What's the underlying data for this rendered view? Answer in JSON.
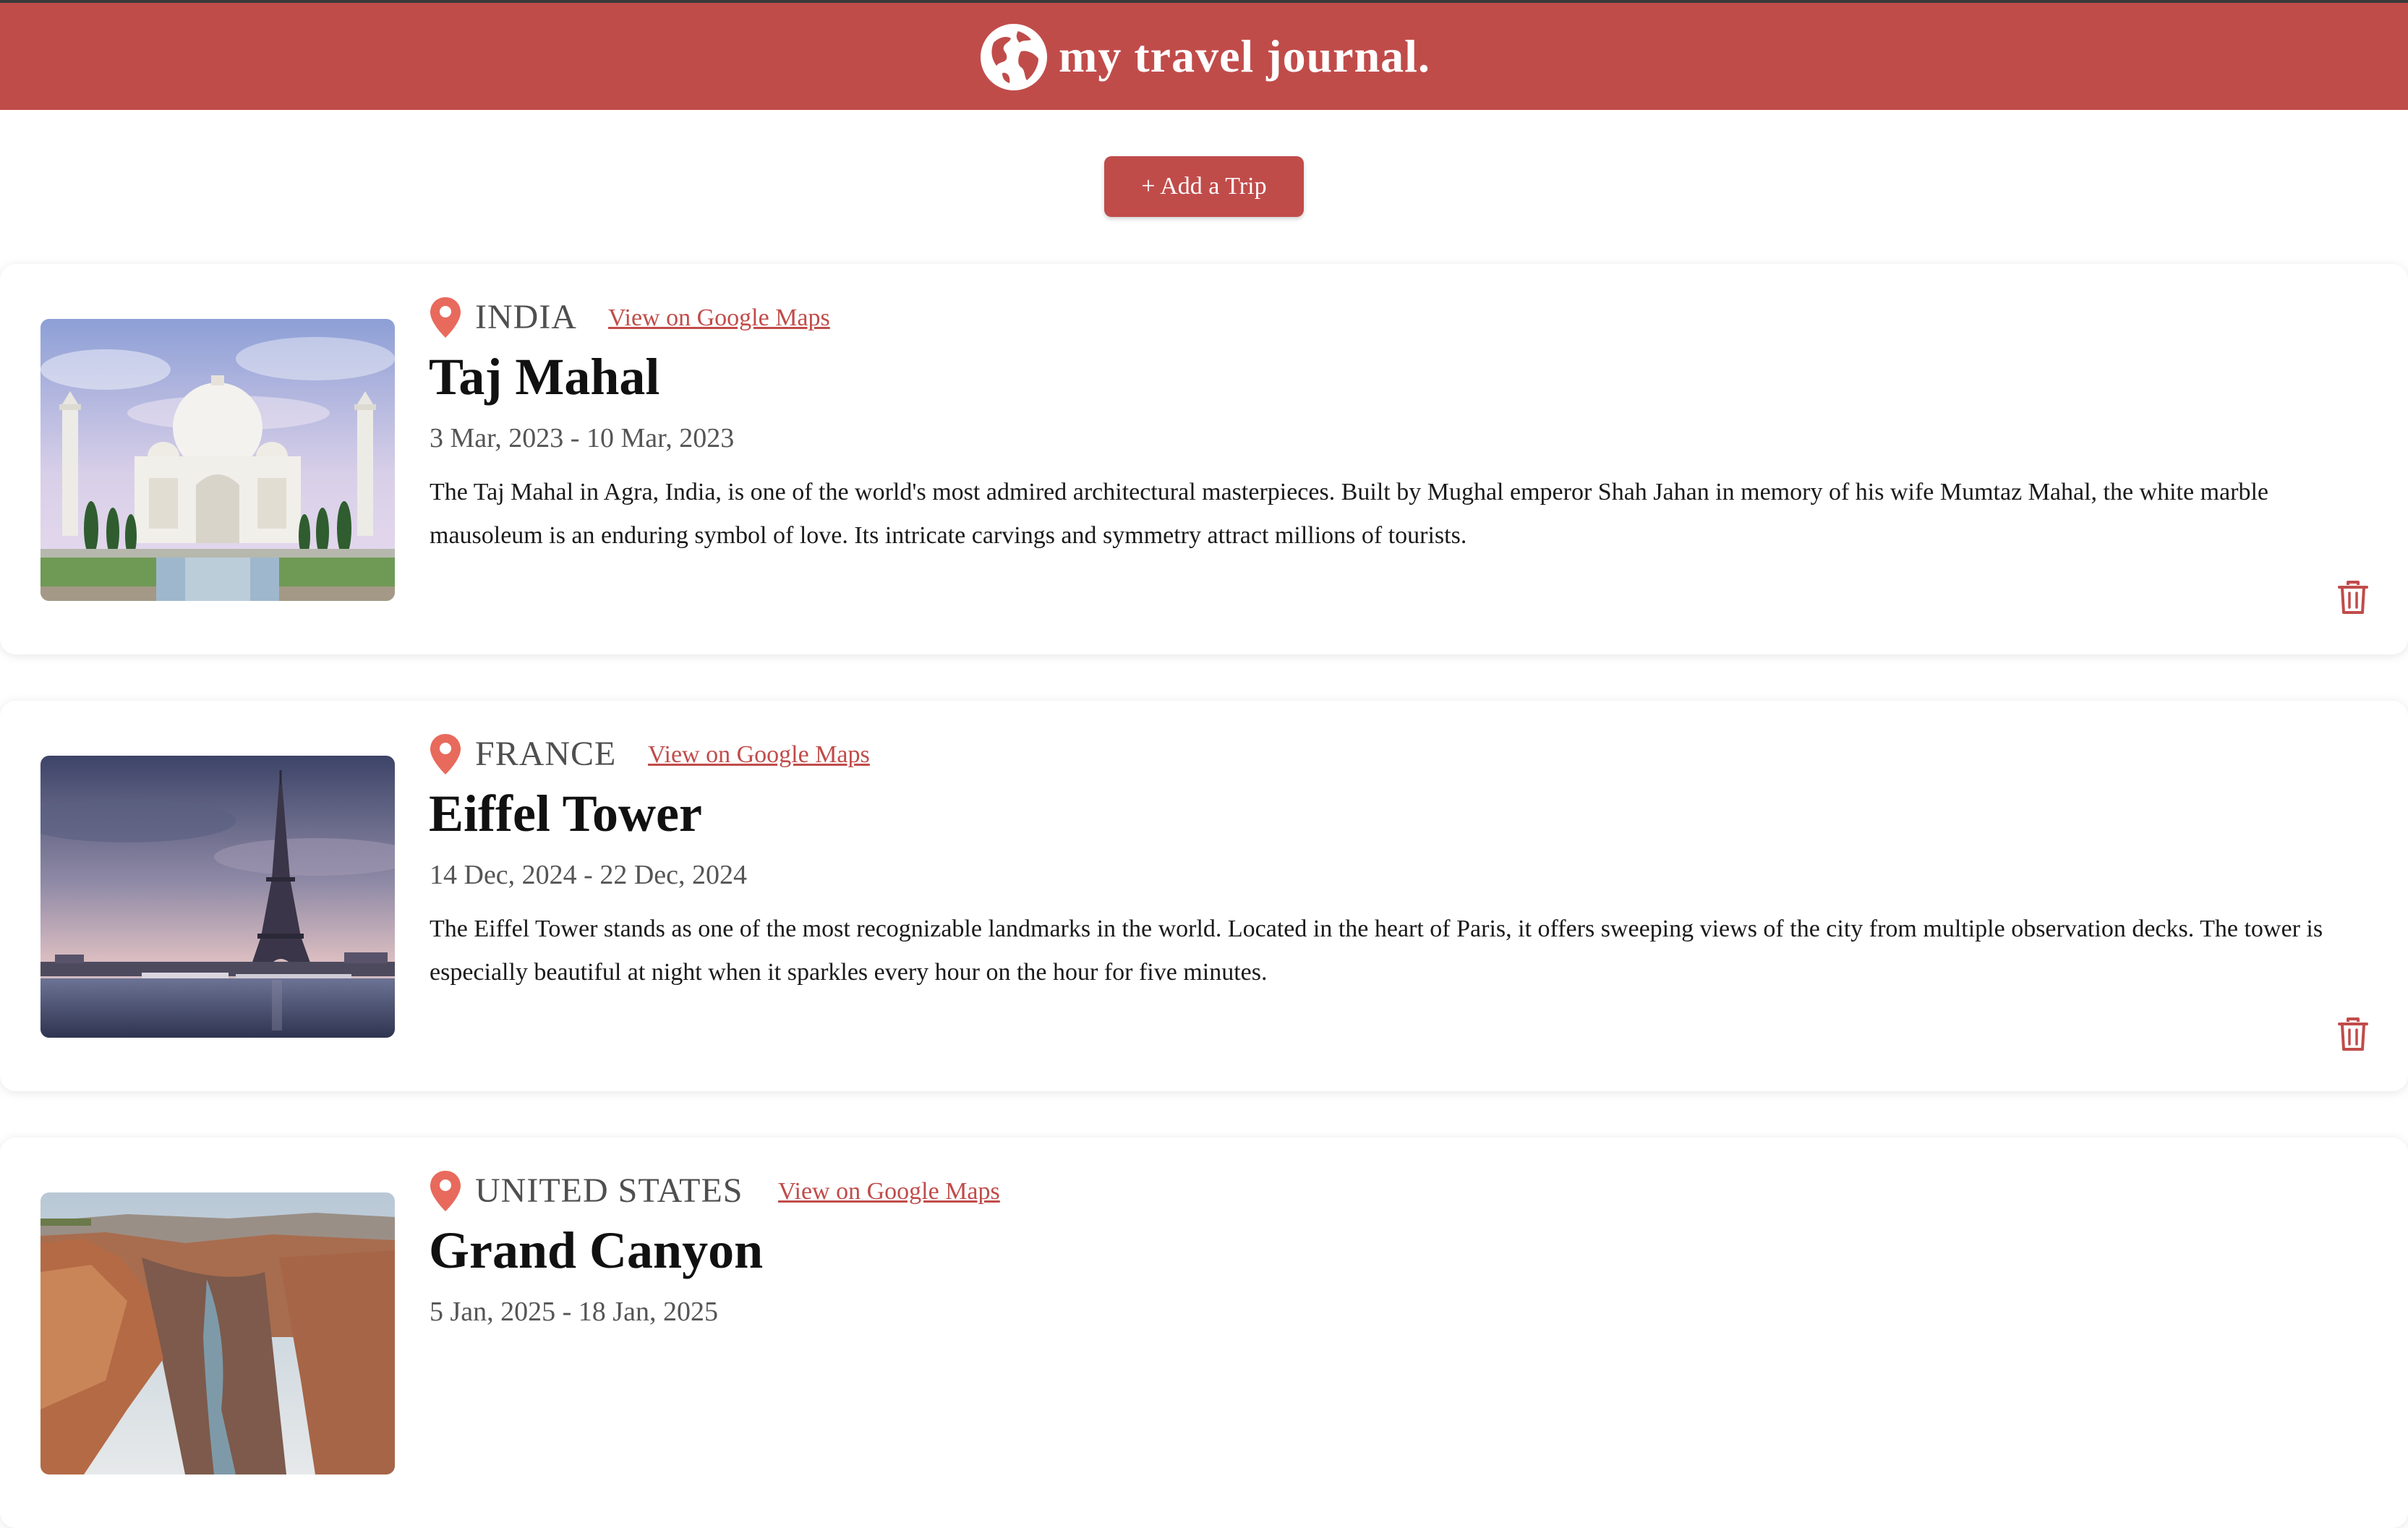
{
  "header": {
    "brand": "my travel journal.",
    "logo_icon": "globe-icon",
    "background": "#c04c4a"
  },
  "toolbar": {
    "add_trip_label": "+ Add a Trip"
  },
  "colors": {
    "accent": "#c04c4a",
    "pin": "#e86a5c"
  },
  "trips": [
    {
      "country": "INDIA",
      "maps_label": "View on Google Maps",
      "title": "Taj Mahal",
      "dates": "3 Mar, 2023 - 10 Mar, 2023",
      "description": "The Taj Mahal in Agra, India, is one of the world's most admired architectural masterpieces. Built by Mughal emperor Shah Jahan in memory of his wife Mumtaz Mahal, the white marble mausoleum is an enduring symbol of love. Its intricate carvings and symmetry attract millions of tourists.",
      "image": "taj-mahal-photo"
    },
    {
      "country": "FRANCE",
      "maps_label": "View on Google Maps",
      "title": "Eiffel Tower",
      "dates": "14 Dec, 2024 - 22 Dec, 2024",
      "description": "The Eiffel Tower stands as one of the most recognizable landmarks in the world. Located in the heart of Paris, it offers sweeping views of the city from multiple observation decks. The tower is especially beautiful at night when it sparkles every hour on the hour for five minutes.",
      "image": "eiffel-tower-photo"
    },
    {
      "country": "UNITED STATES",
      "maps_label": "View on Google Maps",
      "title": "Grand Canyon",
      "dates": "5 Jan, 2025 - 18 Jan, 2025",
      "description": "",
      "image": "grand-canyon-photo"
    }
  ]
}
